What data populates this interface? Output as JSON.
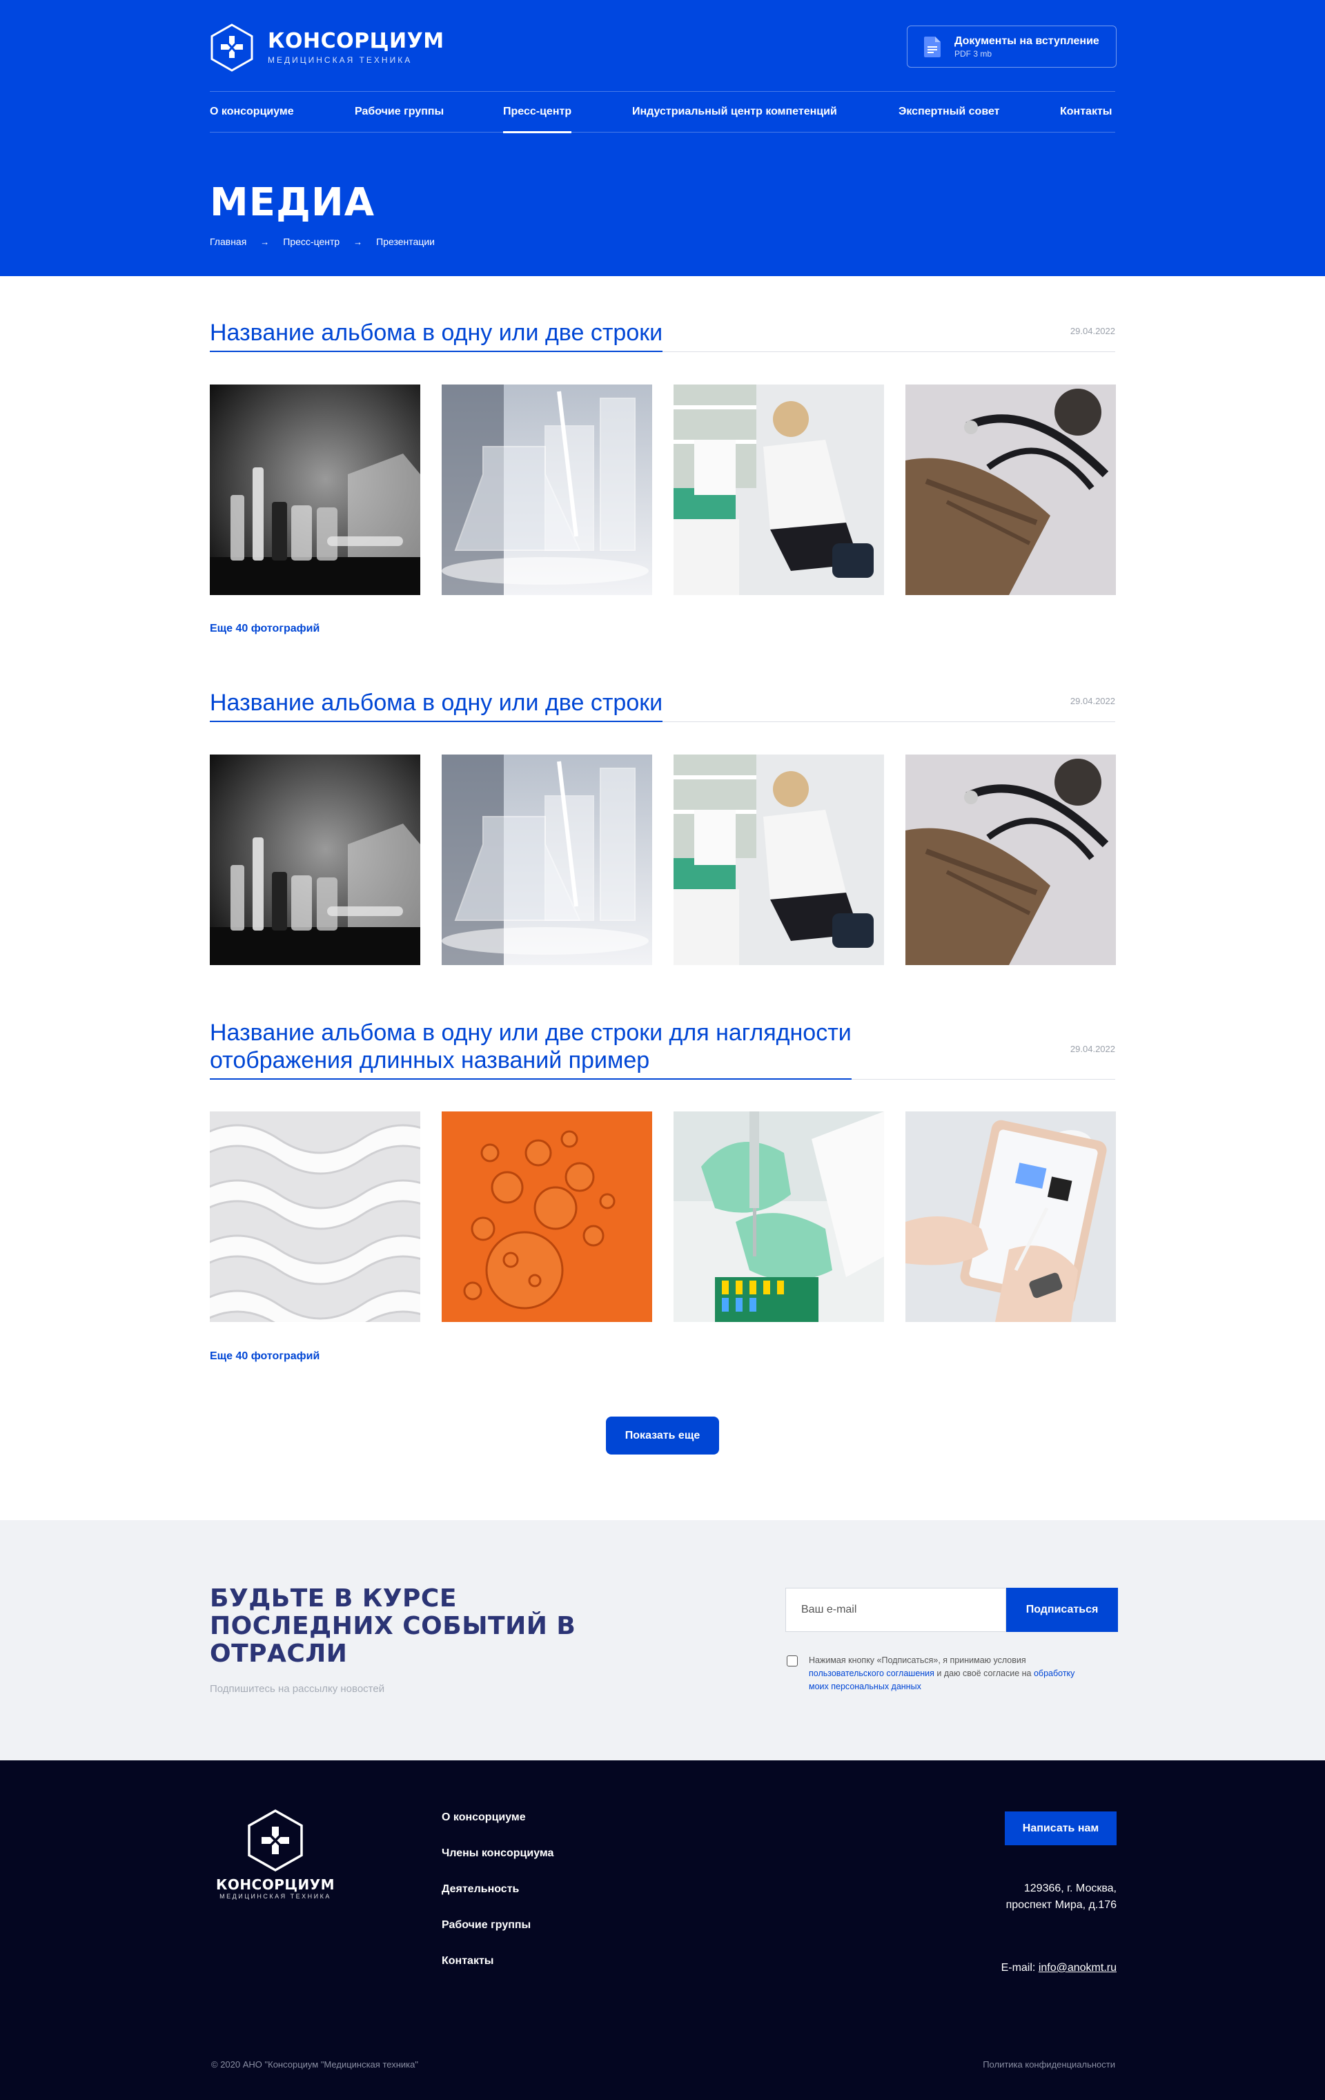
{
  "header": {
    "logo_title": "КОНСОРЦИУМ",
    "logo_subtitle": "медицинская техника",
    "doc_title": "Документы на вступление",
    "doc_meta": "PDF 3 mb"
  },
  "nav": {
    "items": [
      {
        "label": "О консорциуме"
      },
      {
        "label": "Рабочие группы"
      },
      {
        "label": "Пресс-центр",
        "active": true
      },
      {
        "label": "Индустриальный центр компетенций"
      },
      {
        "label": "Экспертный совет"
      },
      {
        "label": "Контакты"
      }
    ]
  },
  "page": {
    "title": "МЕДИА",
    "breadcrumb": [
      "Главная",
      "Пресс-центр",
      "Презентации"
    ],
    "breadcrumb_separator": "→"
  },
  "albums": [
    {
      "title": "Название альбома в одну или две строки",
      "date": "29.04.2022",
      "photos": [
        "ampoules-photo",
        "lab-glassware-photo",
        "microscope-scientist-photo",
        "stethoscope-photo"
      ],
      "more_link": "Еще 40 фотографий"
    },
    {
      "title": "Название альбома в одну или две строки",
      "date": "29.04.2022",
      "photos": [
        "ampoules-photo",
        "lab-glassware-photo",
        "microscope-scientist-photo",
        "stethoscope-photo"
      ]
    },
    {
      "title_line1": "Название альбома в одну или две строки для наглядности",
      "title_line2": "отображения длинных названий пример",
      "date": "29.04.2022",
      "photos": [
        "white-weave-pattern-photo",
        "orange-bubbles-photo",
        "gloved-pipette-photo",
        "tablet-stylus-photo"
      ],
      "more_link": "Еще 40 фотографий"
    }
  ],
  "show_more_label": "Показать еще",
  "subscribe": {
    "title": "Будьте в курсе последних событий в отрасли",
    "subtitle": "Подпишитесь на рассылку новостей",
    "email_placeholder": "Ваш e-mail",
    "button_label": "Подписаться",
    "agree_text_1": "Нажимая кнопку «Подписаться», я принимаю условия",
    "agree_link_1": "пользовательского соглашения",
    "agree_text_2": "и даю своё согласие на",
    "agree_link_2": "обработку моих персональных данных"
  },
  "footer": {
    "logo_title": "КОНСОРЦИУМ",
    "logo_subtitle": "медицинская техника",
    "links": [
      "О консорциуме",
      "Члены консорциума",
      "Деятельность",
      "Рабочие группы",
      "Контакты"
    ],
    "write_button": "Написать нам",
    "address_line1": "129366, г. Москва,",
    "address_line2": "проспект Мира, д.176",
    "email_label": "E-mail:",
    "email": "info@anokmt.ru",
    "copyright": "© 2020 АНО \"Консорциум \"Медицинская техника\"",
    "policy": "Политика конфиденциальности"
  },
  "colors": {
    "brand_blue": "#0047e0",
    "link_blue": "#0046d5",
    "subscribe_title": "#2b3475",
    "footer_bg": "#040621"
  }
}
